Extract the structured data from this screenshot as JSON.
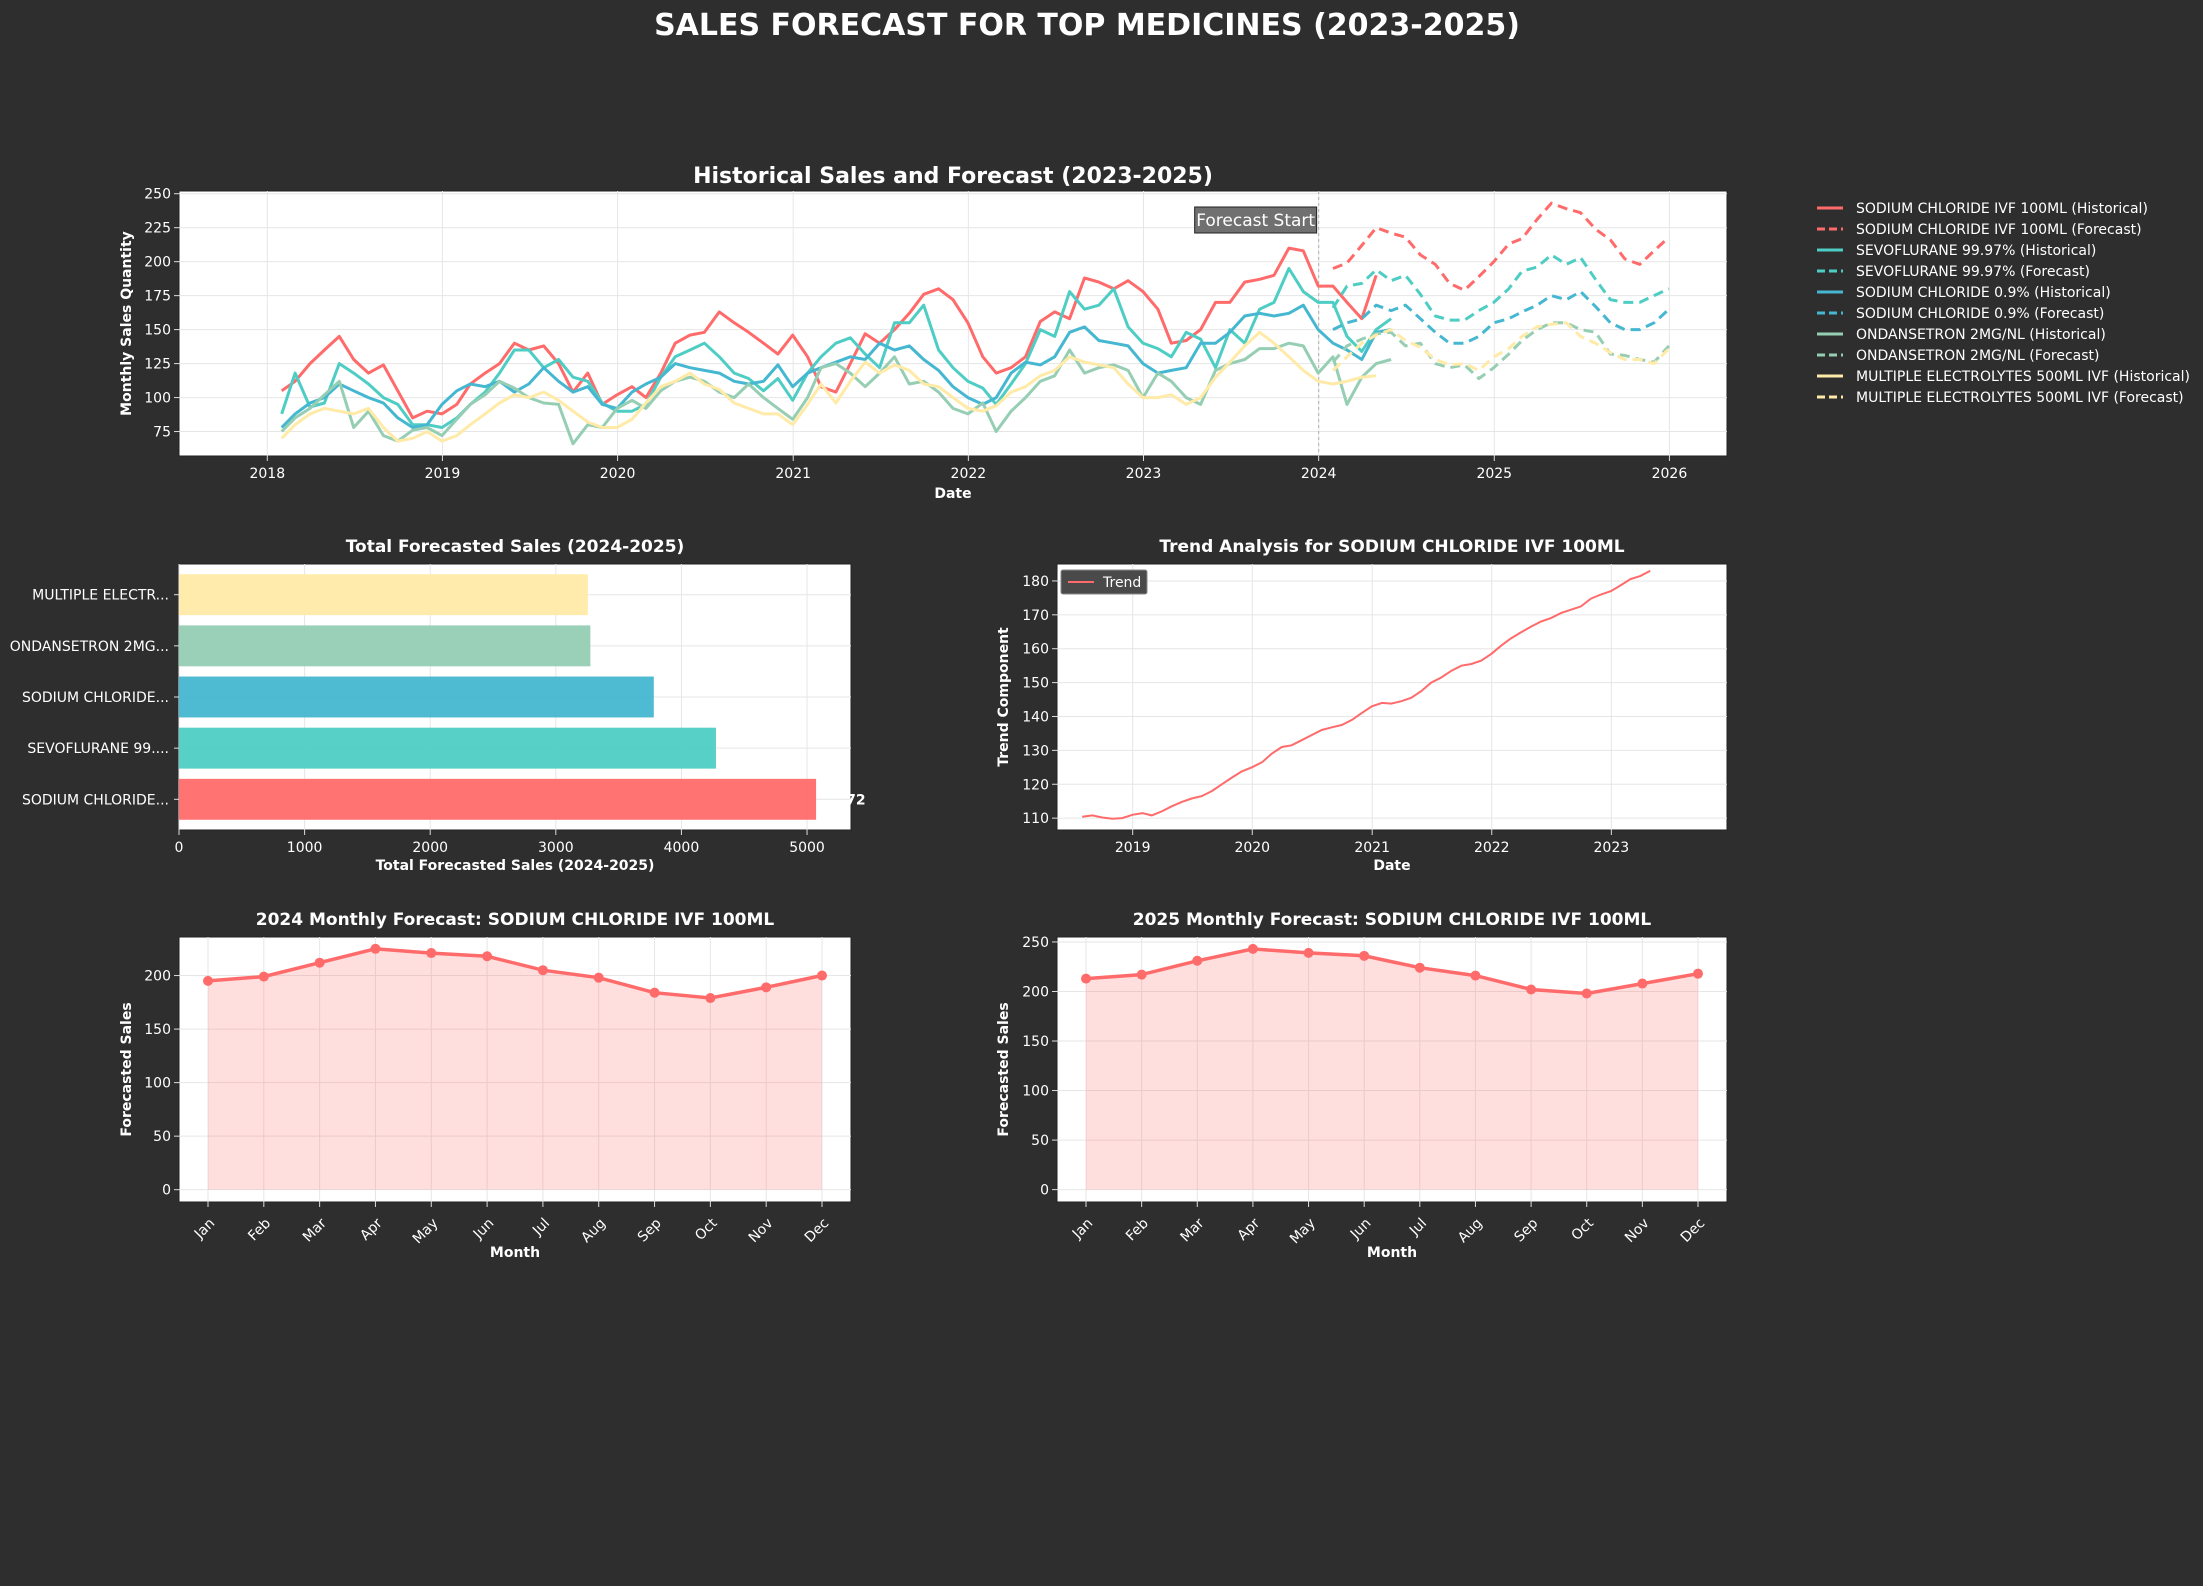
{
  "page_title": "SALES FORECAST FOR TOP MEDICINES (2023-2025)",
  "colors": {
    "background": "#2e2e2e",
    "plot_bg": "#ffffff",
    "grid": "#e6e6e6",
    "text": "#ffffff",
    "sodium_chloride_ivf": "#ff6b6b",
    "sevoflurane": "#4ecdc4",
    "sodium_chloride_09": "#45b7d1",
    "ondansetron": "#96ceb4",
    "multiple_electrolytes": "#ffeaa7"
  },
  "chart_data": [
    {
      "id": "history",
      "type": "line",
      "title": "Historical Sales and Forecast (2023-2025)",
      "xlabel": "Date",
      "ylabel": "Monthly Sales Quantity",
      "xlim": [
        "2017-07-01",
        "2026-05-01"
      ],
      "ylim": [
        57,
        252
      ],
      "yticks": [
        75,
        100,
        125,
        150,
        175,
        200,
        225,
        250
      ],
      "xticks": [
        "2018",
        "2019",
        "2020",
        "2021",
        "2022",
        "2023",
        "2024",
        "2025",
        "2026"
      ],
      "grid": true,
      "legend_position": "outside-right",
      "annotation": "Forecast Start",
      "forecast_start": "2024-01-01",
      "historical_start": "2018-01-31",
      "forecast_dates": "month-end 2024-01 through 2025-12",
      "series": [
        {
          "name": "SODIUM CHLORIDE IVF 100ML (Historical)",
          "color": "#ff6b6b",
          "dashed": false,
          "start": "2018-01-31",
          "values": [
            105,
            112,
            125,
            135,
            145,
            128,
            118,
            124,
            105,
            85,
            90,
            88,
            95,
            110,
            118,
            125,
            140,
            135,
            138,
            125,
            104,
            118,
            95,
            102,
            108,
            100,
            118,
            140,
            146,
            148,
            163,
            155,
            148,
            140,
            132,
            146,
            130,
            108,
            104,
            125,
            147,
            140,
            150,
            162,
            176,
            180,
            172,
            155,
            130,
            118,
            122,
            130,
            156,
            163,
            158,
            188,
            185,
            180,
            186,
            178,
            165,
            140,
            142,
            150,
            170,
            170,
            185,
            187,
            190,
            210,
            208,
            182,
            182,
            170,
            158,
            190
          ]
        },
        {
          "name": "SODIUM CHLORIDE IVF 100ML (Forecast)",
          "color": "#ff6b6b",
          "dashed": true,
          "start": "2024-01-31",
          "values": [
            195,
            199,
            212,
            225,
            221,
            218,
            205,
            198,
            184,
            179,
            189,
            200,
            213,
            217,
            231,
            243,
            239,
            236,
            224,
            216,
            202,
            198,
            208,
            218
          ]
        },
        {
          "name": "SEVOFLURANE 99.97% (Historical)",
          "color": "#4ecdc4",
          "dashed": false,
          "start": "2018-01-31",
          "values": [
            88,
            118,
            93,
            96,
            125,
            118,
            110,
            100,
            95,
            80,
            80,
            78,
            85,
            95,
            104,
            118,
            135,
            135,
            122,
            128,
            115,
            112,
            96,
            90,
            90,
            95,
            115,
            130,
            135,
            140,
            130,
            118,
            114,
            105,
            114,
            98,
            118,
            130,
            140,
            144,
            132,
            122,
            155,
            155,
            168,
            135,
            122,
            112,
            107,
            95,
            110,
            125,
            150,
            145,
            178,
            165,
            168,
            180,
            152,
            140,
            136,
            130,
            148,
            143,
            122,
            150,
            140,
            165,
            170,
            195,
            178,
            170,
            170,
            145,
            134,
            150,
            158
          ]
        },
        {
          "name": "SEVOFLURANE 99.97% (Forecast)",
          "color": "#4ecdc4",
          "dashed": true,
          "start": "2024-01-31",
          "values": [
            166,
            182,
            184,
            194,
            186,
            190,
            176,
            160,
            157,
            157,
            164,
            170,
            180,
            193,
            196,
            205,
            198,
            203,
            187,
            172,
            170,
            170,
            175,
            180
          ]
        },
        {
          "name": "SODIUM CHLORIDE 0.9% (Historical)",
          "color": "#45b7d1",
          "dashed": false,
          "start": "2018-01-31",
          "values": [
            78,
            88,
            96,
            100,
            110,
            105,
            100,
            96,
            85,
            78,
            80,
            95,
            105,
            110,
            108,
            112,
            104,
            110,
            122,
            112,
            104,
            108,
            95,
            92,
            104,
            110,
            115,
            125,
            122,
            120,
            118,
            112,
            110,
            112,
            124,
            108,
            118,
            122,
            126,
            130,
            128,
            140,
            135,
            138,
            128,
            120,
            108,
            100,
            95,
            100,
            118,
            126,
            124,
            130,
            148,
            152,
            142,
            140,
            138,
            125,
            118,
            120,
            122,
            140,
            140,
            148,
            160,
            162,
            160,
            162,
            168,
            150,
            140,
            135,
            128,
            148,
            150
          ]
        },
        {
          "name": "SODIUM CHLORIDE 0.9% (Forecast)",
          "color": "#45b7d1",
          "dashed": true,
          "start": "2024-01-31",
          "values": [
            150,
            155,
            158,
            168,
            164,
            168,
            158,
            148,
            140,
            140,
            145,
            155,
            158,
            163,
            168,
            175,
            172,
            178,
            167,
            155,
            150,
            150,
            155,
            165
          ]
        },
        {
          "name": "ONDANSETRON 2MG/NL (Historical)",
          "color": "#96ceb4",
          "dashed": false,
          "start": "2018-01-31",
          "values": [
            75,
            85,
            92,
            102,
            112,
            78,
            90,
            72,
            68,
            76,
            78,
            72,
            84,
            95,
            102,
            112,
            107,
            100,
            96,
            95,
            66,
            80,
            78,
            92,
            98,
            92,
            105,
            112,
            115,
            112,
            104,
            100,
            110,
            100,
            92,
            84,
            100,
            122,
            125,
            118,
            108,
            118,
            130,
            110,
            112,
            104,
            92,
            88,
            96,
            75,
            90,
            100,
            112,
            116,
            135,
            118,
            122,
            124,
            120,
            100,
            118,
            112,
            100,
            95,
            120,
            125,
            128,
            136,
            136,
            140,
            138,
            118,
            130,
            95,
            115,
            125,
            128
          ]
        },
        {
          "name": "ONDANSETRON 2MG/NL (Forecast)",
          "color": "#96ceb4",
          "dashed": true,
          "start": "2024-01-31",
          "values": [
            126,
            138,
            143,
            147,
            148,
            138,
            140,
            125,
            122,
            124,
            114,
            122,
            132,
            142,
            150,
            155,
            155,
            150,
            148,
            132,
            131,
            128,
            126,
            138
          ]
        },
        {
          "name": "MULTIPLE ELECTROLYTES 500ML IVF (Historical)",
          "color": "#ffeaa7",
          "dashed": false,
          "start": "2018-01-31",
          "values": [
            70,
            80,
            88,
            92,
            90,
            88,
            92,
            78,
            68,
            70,
            75,
            68,
            72,
            80,
            88,
            96,
            102,
            100,
            104,
            98,
            90,
            82,
            78,
            78,
            84,
            96,
            108,
            112,
            118,
            110,
            106,
            96,
            92,
            88,
            88,
            80,
            95,
            110,
            96,
            112,
            126,
            118,
            124,
            120,
            110,
            108,
            100,
            92,
            90,
            94,
            104,
            108,
            116,
            120,
            130,
            126,
            124,
            122,
            110,
            100,
            100,
            102,
            95,
            100,
            115,
            126,
            138,
            148,
            140,
            130,
            120,
            112,
            110,
            112,
            115,
            116
          ]
        },
        {
          "name": "MULTIPLE ELECTROLYTES 500ML IVF (Forecast)",
          "color": "#ffeaa7",
          "dashed": true,
          "start": "2024-01-31",
          "values": [
            120,
            130,
            140,
            146,
            150,
            142,
            137,
            128,
            124,
            125,
            120,
            130,
            136,
            145,
            152,
            154,
            155,
            145,
            140,
            133,
            128,
            128,
            125,
            136
          ]
        }
      ]
    },
    {
      "id": "totals",
      "type": "bar",
      "orientation": "horizontal",
      "title": "Total Forecasted Sales (2024-2025)",
      "xlabel": "Total Forecasted Sales (2024-2025)",
      "ylabel": "",
      "xlim": [
        0,
        5350
      ],
      "xticks": [
        0,
        1000,
        2000,
        3000,
        4000,
        5000
      ],
      "grid": true,
      "categories": [
        "MULTIPLE ELECTR...",
        "ONDANSETRON 2MG...",
        "SODIUM CHLORIDE...",
        "SEVOFLURANE 99....",
        "SODIUM CHLORIDE..."
      ],
      "values": [
        3255,
        3275,
        3780,
        4275,
        5072
      ],
      "bar_colors": [
        "#ffeaa7",
        "#96ceb4",
        "#45b7d1",
        "#4ecdc4",
        "#ff6b6b"
      ],
      "value_labels": [
        "",
        "",
        "",
        "",
        "72"
      ]
    },
    {
      "id": "trend",
      "type": "line",
      "title": "Trend Analysis for SODIUM CHLORIDE IVF 100ML",
      "xlabel": "Date",
      "ylabel": "Trend Component",
      "xlim": [
        "2018-05-15",
        "2023-12-20"
      ],
      "ylim": [
        106.5,
        185
      ],
      "yticks": [
        110,
        120,
        130,
        140,
        150,
        160,
        170,
        180
      ],
      "xticks": [
        "2019",
        "2020",
        "2021",
        "2022",
        "2023"
      ],
      "grid": true,
      "legend_position": "upper-left",
      "series": [
        {
          "name": "Trend",
          "color": "#ff6b6b",
          "start": "2018-07-31",
          "values": [
            110.4,
            110.8,
            110.2,
            109.8,
            110.0,
            111.0,
            111.5,
            110.8,
            112.0,
            113.5,
            114.8,
            115.8,
            116.5,
            118.0,
            120.0,
            122.0,
            123.8,
            125.0,
            126.5,
            129.0,
            131.0,
            131.5,
            133.0,
            134.5,
            136.0,
            136.8,
            137.5,
            139.0,
            141.0,
            143.0,
            144.0,
            143.8,
            144.5,
            145.5,
            147.5,
            150.0,
            151.5,
            153.5,
            155.0,
            155.5,
            156.5,
            158.5,
            161.0,
            163.0,
            164.8,
            166.5,
            168.0,
            169.0,
            170.5,
            171.5,
            172.5,
            174.8,
            176.0,
            177.0,
            178.8,
            180.5,
            181.5,
            183.0
          ]
        }
      ]
    },
    {
      "id": "monthly2024",
      "type": "area",
      "title": "2024 Monthly Forecast: SODIUM CHLORIDE IVF 100ML",
      "xlabel": "Month",
      "ylabel": "Forecasted Sales",
      "ylim": [
        -11.5,
        236
      ],
      "yticks": [
        0,
        50,
        100,
        150,
        200
      ],
      "grid": true,
      "categories": [
        "Jan",
        "Feb",
        "Mar",
        "Apr",
        "May",
        "Jun",
        "Jul",
        "Aug",
        "Sep",
        "Oct",
        "Nov",
        "Dec"
      ],
      "values": [
        195,
        199,
        212,
        225,
        221,
        218,
        205,
        198,
        184,
        179,
        189,
        200
      ],
      "color": "#ff6b6b"
    },
    {
      "id": "monthly2025",
      "type": "area",
      "title": "2025 Monthly Forecast: SODIUM CHLORIDE IVF 100ML",
      "xlabel": "Month",
      "ylabel": "Forecasted Sales",
      "ylim": [
        -12.5,
        255
      ],
      "yticks": [
        0,
        50,
        100,
        150,
        200,
        250
      ],
      "grid": true,
      "categories": [
        "Jan",
        "Feb",
        "Mar",
        "Apr",
        "May",
        "Jun",
        "Jul",
        "Aug",
        "Sep",
        "Oct",
        "Nov",
        "Dec"
      ],
      "values": [
        213,
        217,
        231,
        243,
        239,
        236,
        224,
        216,
        202,
        198,
        208,
        218
      ],
      "color": "#ff6b6b"
    }
  ]
}
